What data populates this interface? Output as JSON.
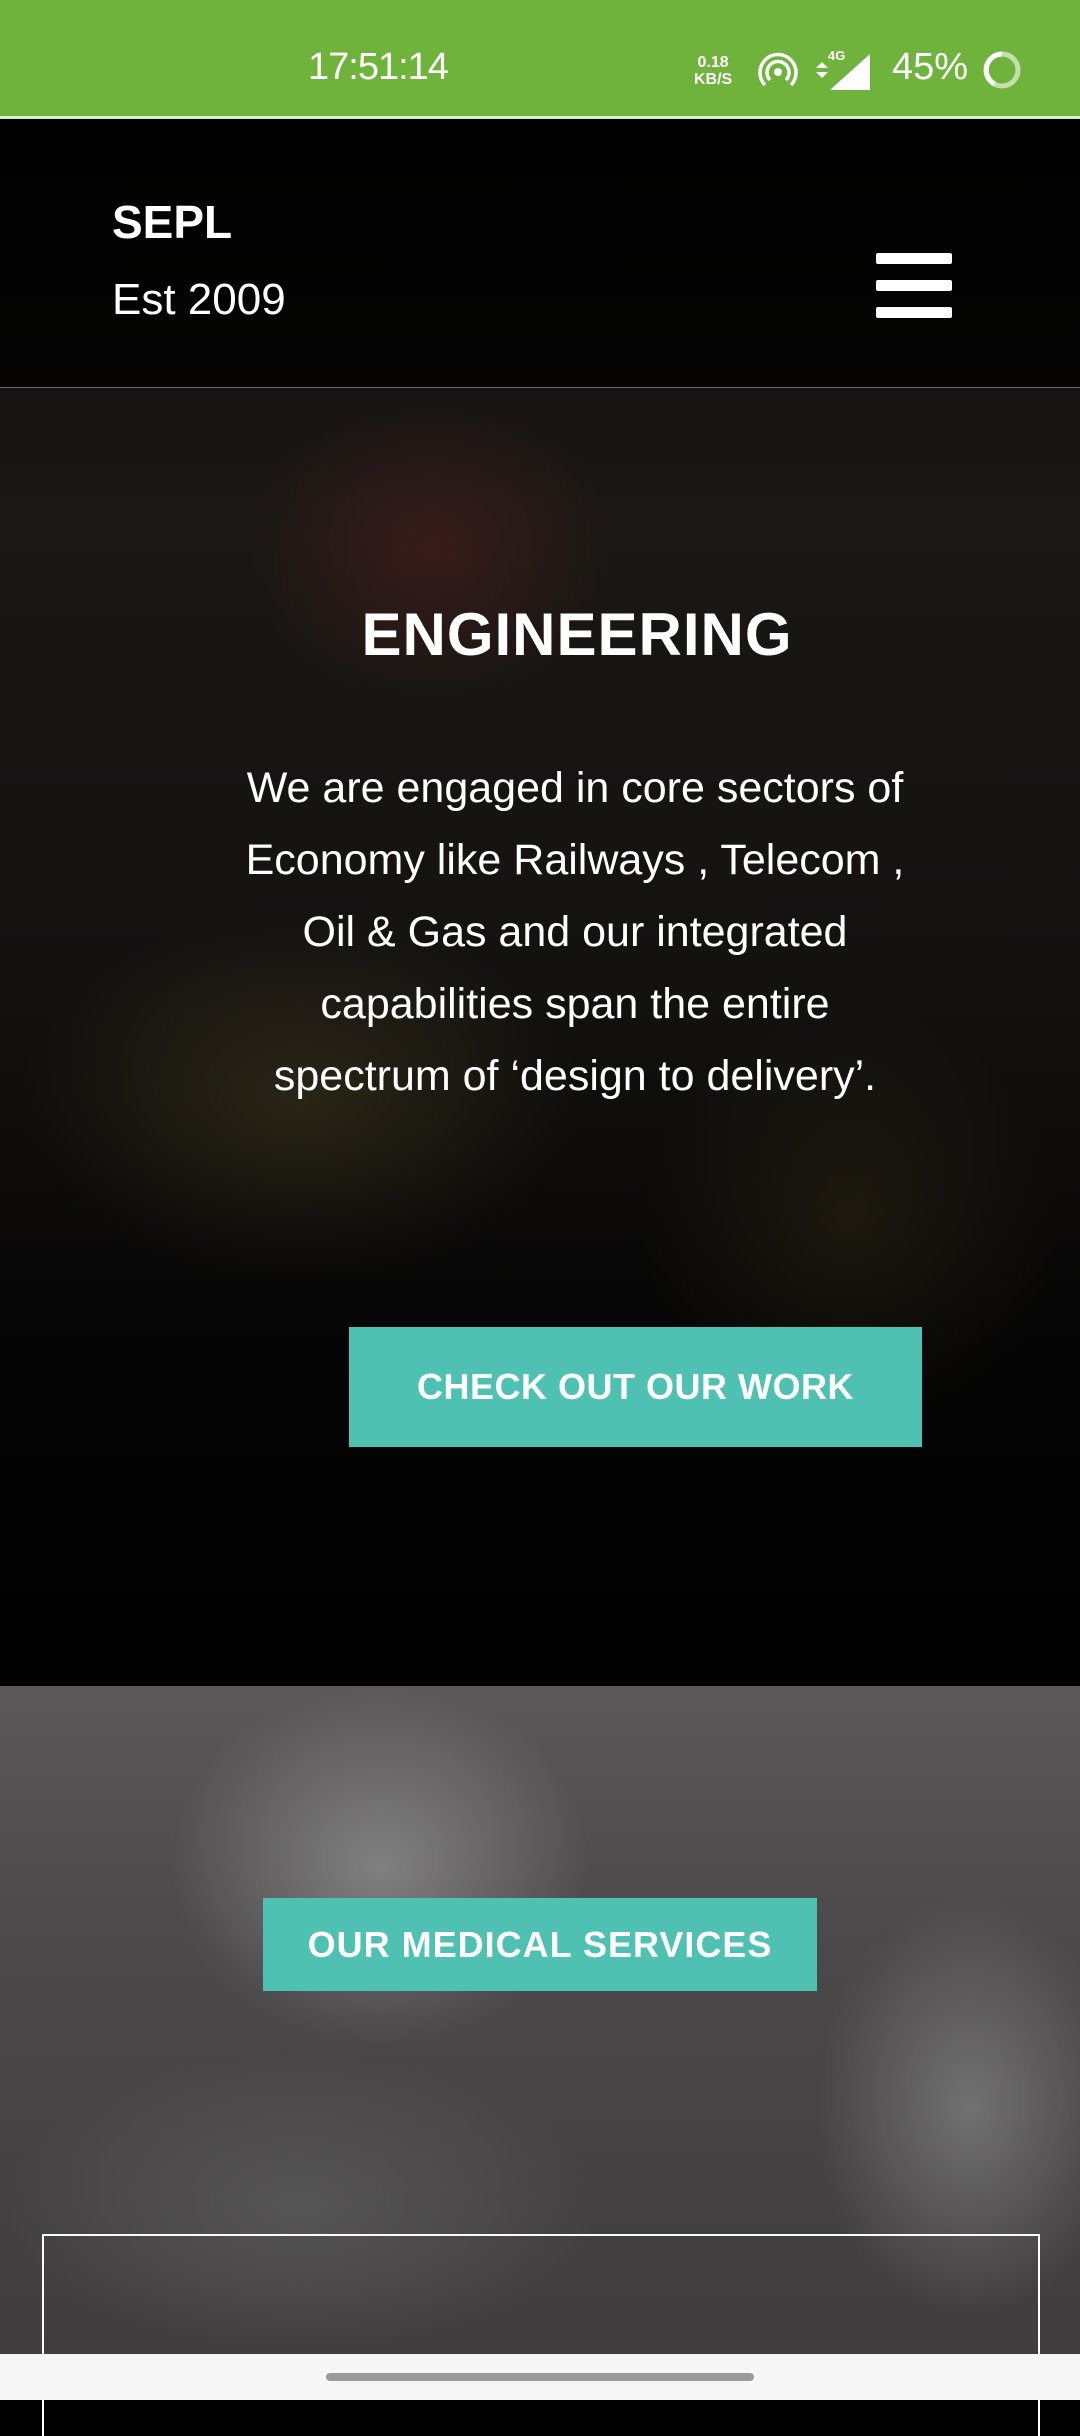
{
  "status_bar": {
    "time": "17:51:14",
    "net_speed_value": "0.18",
    "net_speed_unit": "KB/S",
    "network_type": "4G",
    "battery": "45%",
    "icons": [
      "hotspot-icon",
      "signal-icon",
      "battery-ring-icon"
    ],
    "bg_color": "#6fb33c"
  },
  "header": {
    "brand": "SEPL",
    "established": "Est 2009",
    "menu_icon": "hamburger-icon"
  },
  "hero": {
    "title": "ENGINEERING",
    "description": "We are engaged in core sectors of Economy like Railways , Telecom , Oil & Gas and our integrated capabilities span the entire spectrum of ‘design to delivery’.",
    "cta_label": "CHECK OUT OUR WORK"
  },
  "medical": {
    "button_label": "OUR MEDICAL SERVICES"
  },
  "colors": {
    "accent": "#4fc1b3",
    "status_green": "#6fb33c"
  }
}
